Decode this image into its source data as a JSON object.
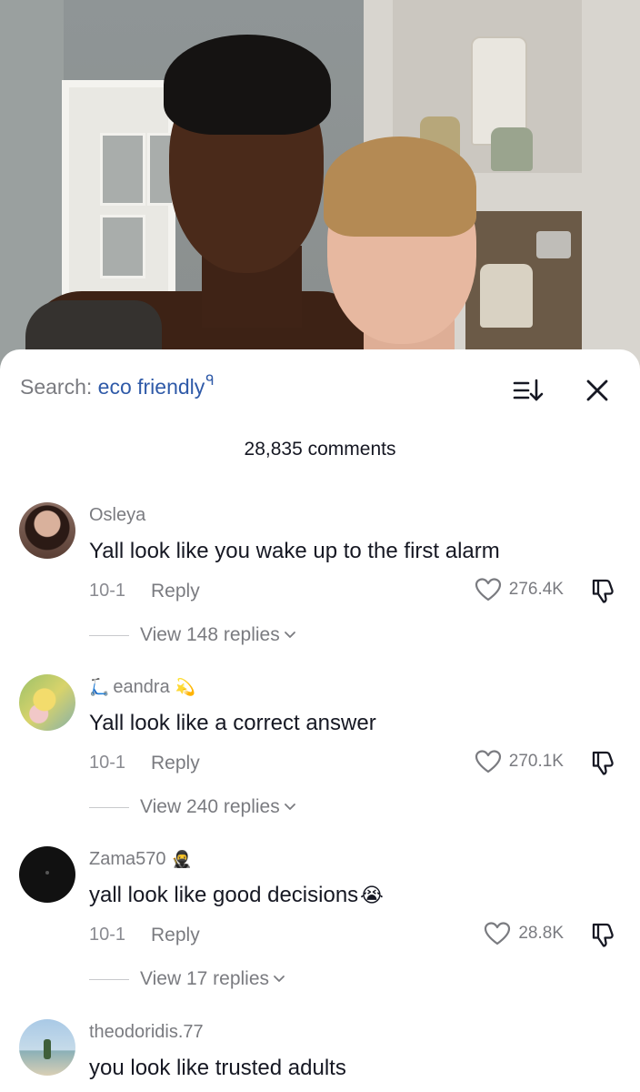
{
  "search": {
    "prefix": "Search: ",
    "term": "eco friendly",
    "glyph": "ᑫ"
  },
  "header": {
    "sort_icon": "sort-icon",
    "close_icon": "close-icon"
  },
  "comments_count": "28,835 comments",
  "comments": [
    {
      "username": "Osleya",
      "username_lead": "",
      "username_emoji": "",
      "text": "Yall look like you wake up to the first alarm",
      "text_emoji": "",
      "date": "10-1",
      "reply_label": "Reply",
      "likes": "276.4K",
      "replies": "View 148 replies"
    },
    {
      "username": "eandra",
      "username_lead": "🛴",
      "username_emoji": "💫",
      "text": "Yall look like a correct answer",
      "text_emoji": "",
      "date": "10-1",
      "reply_label": "Reply",
      "likes": "270.1K",
      "replies": "View 240 replies"
    },
    {
      "username": "Zama570",
      "username_lead": "",
      "username_emoji": "🥷",
      "text": "yall look like good decisions",
      "text_emoji": "😭",
      "date": "10-1",
      "reply_label": "Reply",
      "likes": "28.8K",
      "replies": "View 17 replies"
    },
    {
      "username": "theodoridis.77",
      "username_lead": "",
      "username_emoji": "",
      "text": "you look like trusted adults",
      "text_emoji": "",
      "date": "",
      "reply_label": "",
      "likes": "",
      "replies": ""
    }
  ],
  "colors": {
    "search_term": "#2f5aa8",
    "muted": "#7a7b80",
    "text": "#161823"
  }
}
